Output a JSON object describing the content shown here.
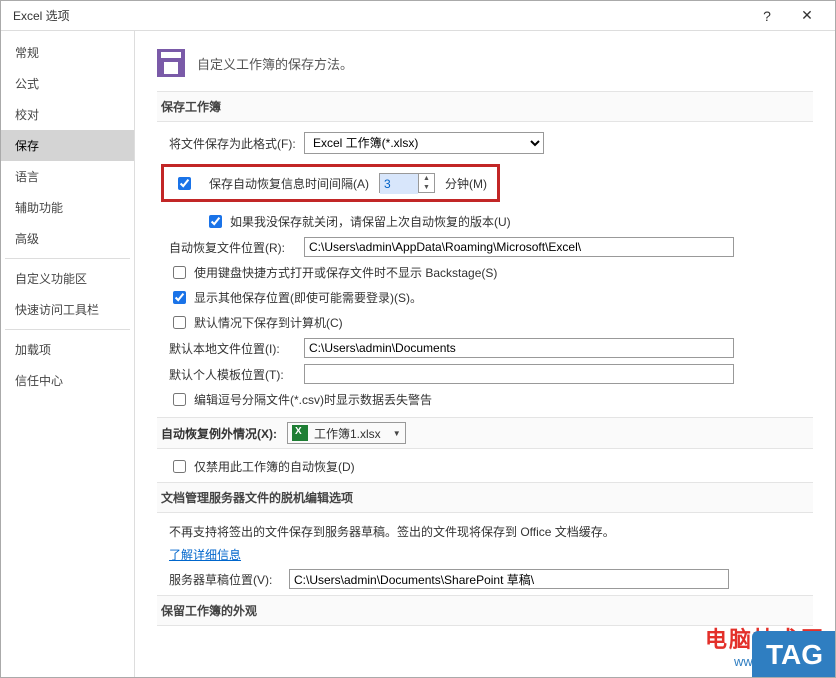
{
  "window": {
    "title": "Excel 选项",
    "help": "?",
    "close": "✕"
  },
  "sidebar": {
    "items": [
      "常规",
      "公式",
      "校对",
      "保存",
      "语言",
      "辅助功能",
      "高级",
      "自定义功能区",
      "快速访问工具栏",
      "加载项",
      "信任中心"
    ],
    "selectedIndex": 3
  },
  "header": {
    "text": "自定义工作簿的保存方法。"
  },
  "sections": {
    "saveWorkbook": {
      "title": "保存工作簿",
      "fileFormatLabel": "将文件保存为此格式(F):",
      "fileFormatValue": "Excel 工作簿(*.xlsx)",
      "autoRecover": {
        "enabled": true,
        "label": "保存自动恢复信息时间间隔(A)",
        "value": "3",
        "unit": "分钟(M)"
      },
      "keepLast": {
        "enabled": true,
        "label": "如果我没保存就关闭，请保留上次自动恢复的版本(U)"
      },
      "autoRecoverPathLabel": "自动恢复文件位置(R):",
      "autoRecoverPath": "C:\\Users\\admin\\AppData\\Roaming\\Microsoft\\Excel\\",
      "backstage": {
        "enabled": false,
        "label": "使用键盘快捷方式打开或保存文件时不显示 Backstage(S)"
      },
      "showOtherSave": {
        "enabled": true,
        "label": "显示其他保存位置(即使可能需要登录)(S)。"
      },
      "defaultSaveLocal": {
        "enabled": false,
        "label": "默认情况下保存到计算机(C)"
      },
      "defaultLocalLabel": "默认本地文件位置(I):",
      "defaultLocalPath": "C:\\Users\\admin\\Documents",
      "defaultTemplateLabel": "默认个人模板位置(T):",
      "defaultTemplatePath": "",
      "csvWarn": {
        "enabled": false,
        "label": "编辑逗号分隔文件(*.csv)时显示数据丢失警告"
      }
    },
    "autoRecoverException": {
      "title": "自动恢复例外情况(X):",
      "workbook": "工作簿1.xlsx",
      "disableThis": {
        "enabled": false,
        "label": "仅禁用此工作簿的自动恢复(D)"
      }
    },
    "offlineEdit": {
      "title": "文档管理服务器文件的脱机编辑选项",
      "note": "不再支持将签出的文件保存到服务器草稿。签出的文件现将保存到 Office 文档缓存。",
      "link": "了解详细信息",
      "draftLabel": "服务器草稿位置(V):",
      "draftPath": "C:\\Users\\admin\\Documents\\SharePoint 草稿\\"
    },
    "appearance": {
      "title": "保留工作簿的外观"
    }
  },
  "watermark": {
    "line1": "电脑技术网",
    "line2": "www.tagxp.com",
    "tag": "TAG"
  }
}
